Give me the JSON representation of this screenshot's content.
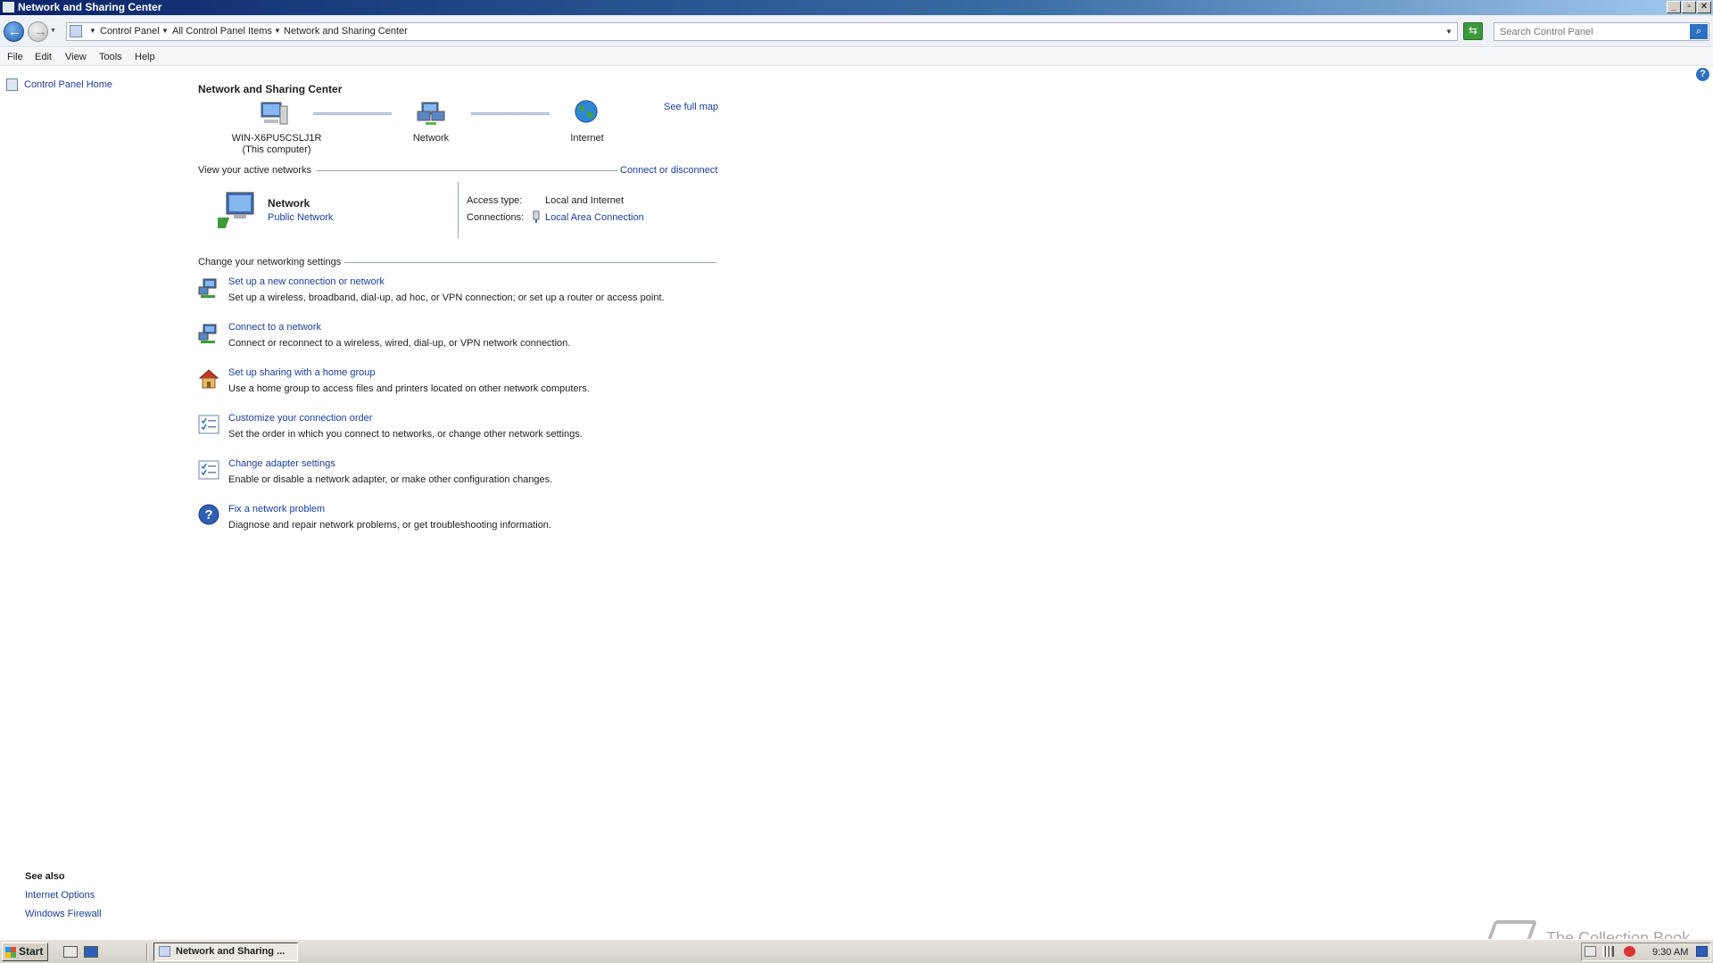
{
  "window": {
    "title": "Network and Sharing Center"
  },
  "address": {
    "crumbs": [
      "Control Panel",
      "All Control Panel Items",
      "Network and Sharing Center"
    ]
  },
  "search": {
    "placeholder": "Search Control Panel"
  },
  "menu": [
    "File",
    "Edit",
    "View",
    "Tools",
    "Help"
  ],
  "left_pane": {
    "home": "Control Panel Home",
    "see_also_title": "See also",
    "see_also": [
      "Internet Options",
      "Windows Firewall"
    ]
  },
  "main": {
    "title": "Network and Sharing Center",
    "map": {
      "computer_name": "WIN-X6PU5CSLJ1R",
      "computer_note": "(This computer)",
      "network": "Network",
      "internet": "Internet",
      "see_full_map": "See full map"
    },
    "active": {
      "header": "View your active networks",
      "connect_link": "Connect or disconnect",
      "name": "Network",
      "type": "Public Network",
      "access_label": "Access type:",
      "access_value": "Local and Internet",
      "conn_label": "Connections:",
      "conn_value": "Local Area Connection"
    },
    "change": {
      "header": "Change your networking settings",
      "tasks": [
        {
          "title": "Set up a new connection or network",
          "desc": "Set up a wireless, broadband, dial-up, ad hoc, or VPN connection; or set up a router or access point.",
          "icon": "network-setup-icon"
        },
        {
          "title": "Connect to a network",
          "desc": "Connect or reconnect to a wireless, wired, dial-up, or VPN network connection.",
          "icon": "connect-network-icon"
        },
        {
          "title": "Set up sharing with a home group",
          "desc": "Use a home group to access files and printers located on other network computers.",
          "icon": "home-group-icon"
        },
        {
          "title": "Customize your connection order",
          "desc": "Set the order in which you connect to networks, or change other network settings.",
          "icon": "checklist-icon"
        },
        {
          "title": "Change adapter settings",
          "desc": "Enable or disable a network adapter, or make other configuration changes.",
          "icon": "checklist-icon"
        },
        {
          "title": "Fix a network problem",
          "desc": "Diagnose and repair network problems, or get troubleshooting information.",
          "icon": "help-circle-icon"
        }
      ]
    }
  },
  "taskbar": {
    "start": "Start",
    "window_button": "Network and Sharing ...",
    "clock": "9:30 AM"
  },
  "watermark": "The Collection Book",
  "colors": {
    "link": "#1a3e9c",
    "titlebar": "#0a246a"
  }
}
